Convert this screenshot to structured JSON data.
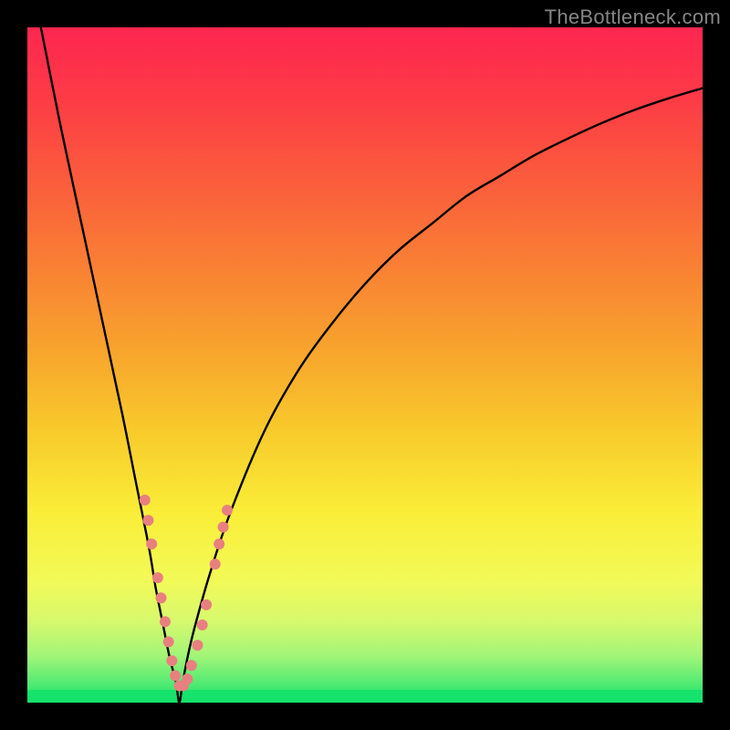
{
  "watermark": "TheBottleneck.com",
  "chart_data": {
    "type": "line",
    "title": "",
    "xlabel": "",
    "ylabel": "",
    "xlim": [
      0,
      100
    ],
    "ylim": [
      0,
      100
    ],
    "grid": false,
    "legend": false,
    "curve": {
      "description": "V-shaped bottleneck curve",
      "min_x": 22.5,
      "x": [
        2,
        5,
        8,
        11,
        14,
        16,
        18,
        19,
        20,
        21,
        22,
        22.5,
        23,
        24,
        25,
        27,
        30,
        35,
        40,
        45,
        50,
        55,
        60,
        65,
        70,
        75,
        80,
        85,
        90,
        95,
        100
      ],
      "y": [
        100,
        85,
        71,
        57,
        43,
        33,
        23,
        17,
        12,
        7,
        3,
        0,
        3,
        8,
        12,
        19,
        28,
        40,
        49,
        56,
        62,
        67,
        71,
        75,
        78,
        81,
        83.5,
        85.8,
        87.8,
        89.5,
        91
      ]
    },
    "markers": {
      "color": "#e88080",
      "radius_px": 6,
      "points": [
        {
          "x": 17.4,
          "y": 30.0
        },
        {
          "x": 17.9,
          "y": 27.0
        },
        {
          "x": 18.4,
          "y": 23.5
        },
        {
          "x": 19.3,
          "y": 18.5
        },
        {
          "x": 19.8,
          "y": 15.5
        },
        {
          "x": 20.4,
          "y": 12.0
        },
        {
          "x": 20.9,
          "y": 9.0
        },
        {
          "x": 21.4,
          "y": 6.2
        },
        {
          "x": 21.9,
          "y": 4.0
        },
        {
          "x": 22.5,
          "y": 2.5
        },
        {
          "x": 23.1,
          "y": 2.5
        },
        {
          "x": 23.7,
          "y": 3.5
        },
        {
          "x": 24.3,
          "y": 5.5
        },
        {
          "x": 25.2,
          "y": 8.5
        },
        {
          "x": 25.9,
          "y": 11.5
        },
        {
          "x": 26.5,
          "y": 14.5
        },
        {
          "x": 27.8,
          "y": 20.5
        },
        {
          "x": 28.4,
          "y": 23.5
        },
        {
          "x": 29.0,
          "y": 26.0
        },
        {
          "x": 29.6,
          "y": 28.5
        }
      ]
    },
    "gradient_stops": [
      {
        "offset": 0.0,
        "color": "#fd2650"
      },
      {
        "offset": 0.1,
        "color": "#fd3a46"
      },
      {
        "offset": 0.22,
        "color": "#fb5a3d"
      },
      {
        "offset": 0.35,
        "color": "#f97f34"
      },
      {
        "offset": 0.48,
        "color": "#f8a52d"
      },
      {
        "offset": 0.6,
        "color": "#f8cb2b"
      },
      {
        "offset": 0.72,
        "color": "#faee38"
      },
      {
        "offset": 0.82,
        "color": "#f2fa58"
      },
      {
        "offset": 0.88,
        "color": "#d6f96e"
      },
      {
        "offset": 0.93,
        "color": "#a3f577"
      },
      {
        "offset": 0.965,
        "color": "#5fec74"
      },
      {
        "offset": 1.0,
        "color": "#16e36b"
      }
    ]
  }
}
